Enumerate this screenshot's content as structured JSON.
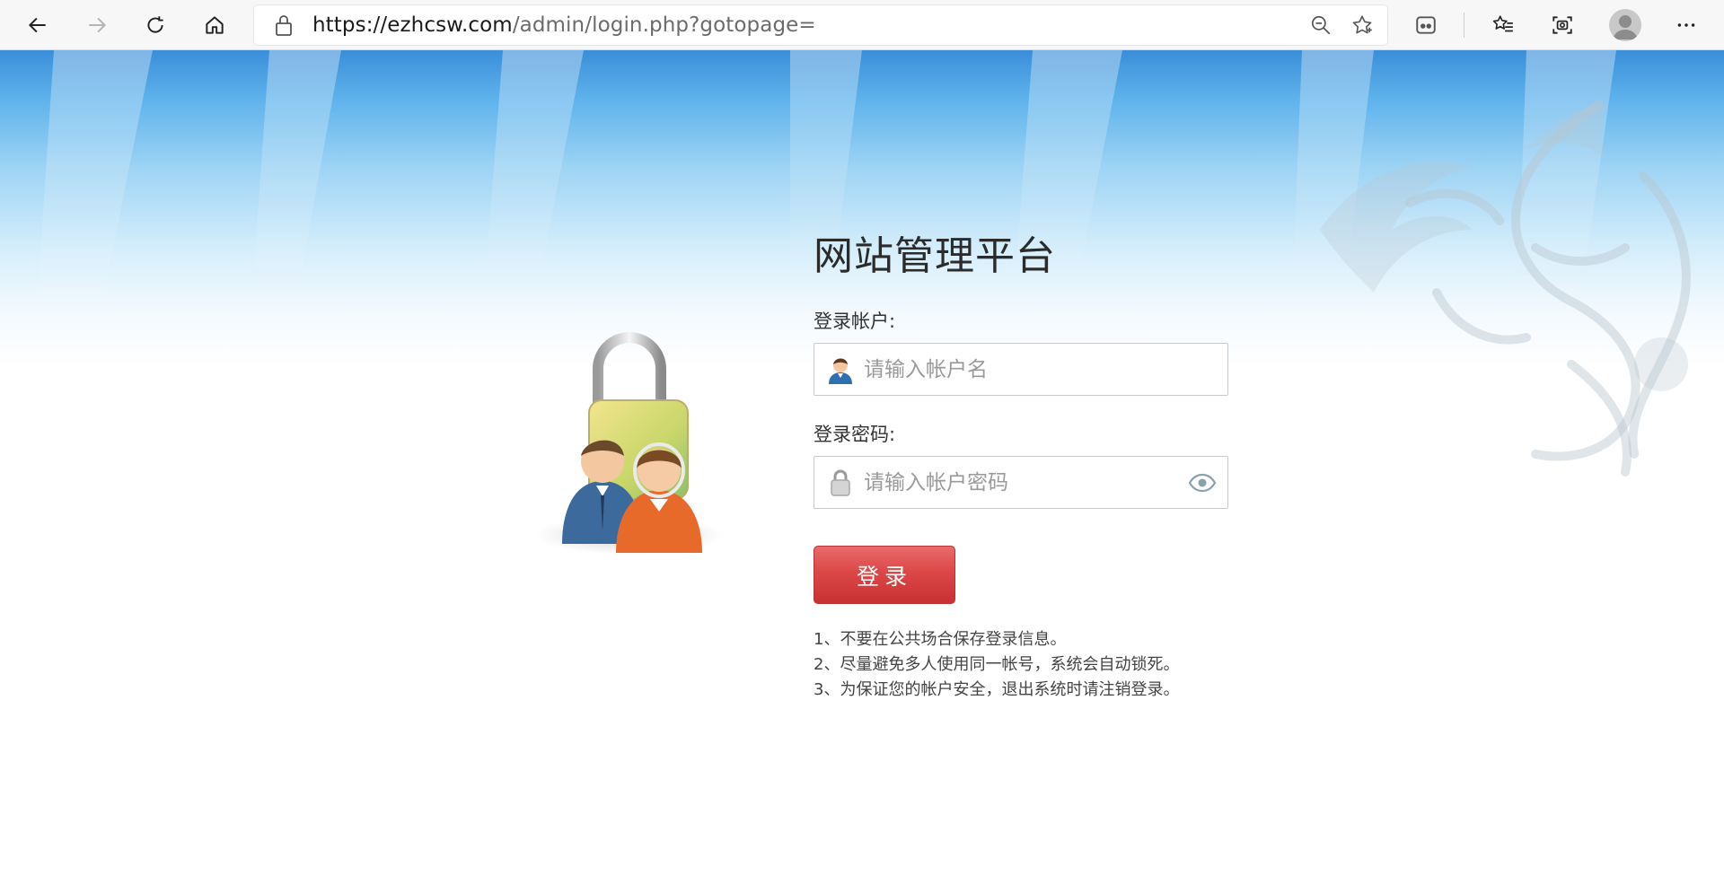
{
  "browser": {
    "url_host": "https://ezhcsw.com",
    "url_path": "/admin/login.php?gotopage=",
    "icons": [
      "back-icon",
      "forward-icon",
      "refresh-icon",
      "home-icon",
      "lock-icon",
      "zoom-icon",
      "favorite-star-icon",
      "extensions-icon",
      "favorites-list-icon",
      "screenshot-icon",
      "profile-icon",
      "more-icon"
    ]
  },
  "login": {
    "title": "网站管理平台",
    "account_label": "登录帐户:",
    "account_placeholder": "请输入帐户名",
    "password_label": "登录密码:",
    "password_placeholder": "请输入帐户密码",
    "submit_label": "登录",
    "tips": [
      "1、不要在公共场合保存登录信息。",
      "2、尽量避免多人使用同一帐号，系统会自动锁死。",
      "3、为保证您的帐户安全，退出系统时请注销登录。"
    ]
  },
  "colors": {
    "accent_button": "#d94444",
    "sky_top": "#3a8ed9"
  }
}
